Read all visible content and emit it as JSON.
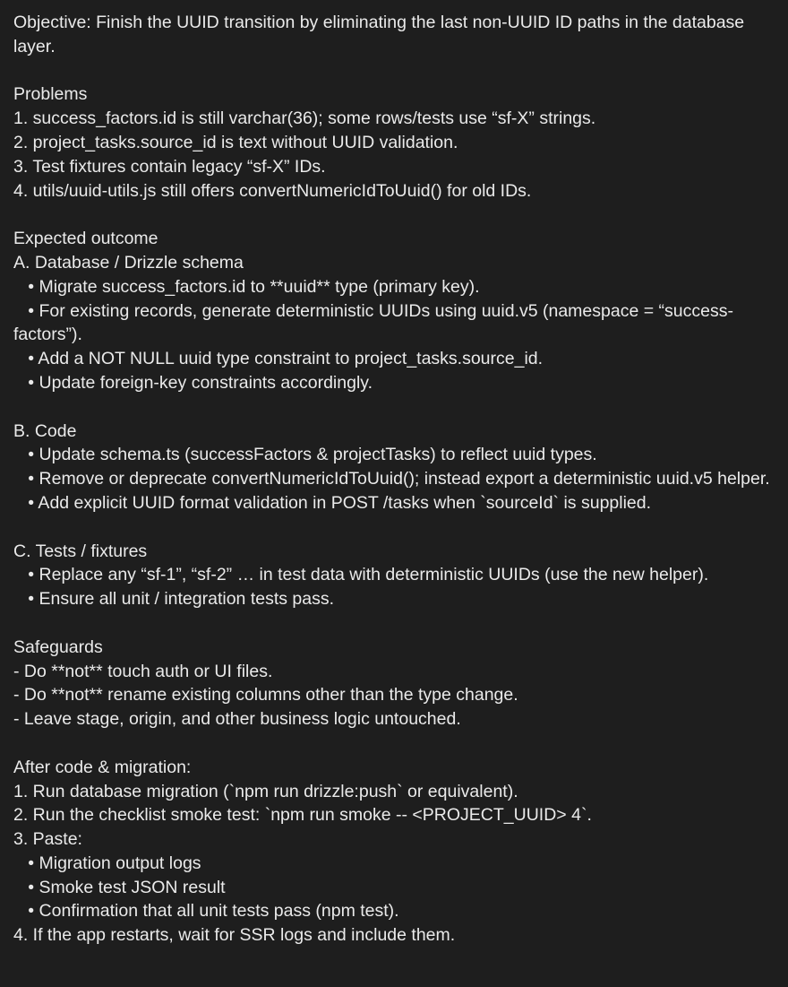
{
  "document": {
    "lines": [
      "Objective: Finish the UUID transition by eliminating the last non-UUID ID paths in the database layer.",
      "",
      "Problems",
      "1. success_factors.id is still varchar(36); some rows/tests use “sf-X” strings.",
      "2. project_tasks.source_id is text without UUID validation.",
      "3. Test fixtures contain legacy “sf-X” IDs.",
      "4. utils/uuid-utils.js still offers convertNumericIdToUuid() for old IDs.",
      "",
      "Expected outcome",
      "A. Database / Drizzle schema",
      "   • Migrate success_factors.id to **uuid** type (primary key).",
      "   • For existing records, generate deterministic UUIDs using uuid.v5 (namespace = “success-factors”).",
      "   • Add a NOT NULL uuid type constraint to project_tasks.source_id.",
      "   • Update foreign-key constraints accordingly.",
      "",
      "B. Code",
      "   • Update schema.ts (successFactors & projectTasks) to reflect uuid types.",
      "   • Remove or deprecate convertNumericIdToUuid(); instead export a deterministic uuid.v5 helper.",
      "   • Add explicit UUID format validation in POST /tasks when `sourceId` is supplied.",
      "",
      "C. Tests / fixtures",
      "   • Replace any “sf-1”, “sf-2” … in test data with deterministic UUIDs (use the new helper).",
      "   • Ensure all unit / integration tests pass.",
      "",
      "Safeguards",
      "- Do **not** touch auth or UI files.",
      "- Do **not** rename existing columns other than the type change.",
      "- Leave stage, origin, and other business logic untouched.",
      "",
      "After code & migration:",
      "1. Run database migration (`npm run drizzle:push` or equivalent).",
      "2. Run the checklist smoke test: `npm run smoke -- <PROJECT_UUID> 4`.",
      "3. Paste:",
      "   • Migration output logs",
      "   • Smoke test JSON result",
      "   • Confirmation that all unit tests pass (npm test).",
      "4. If the app restarts, wait for SSR logs and include them."
    ]
  },
  "colors": {
    "background": "#1e1e1e",
    "text": "#eaeaea"
  }
}
